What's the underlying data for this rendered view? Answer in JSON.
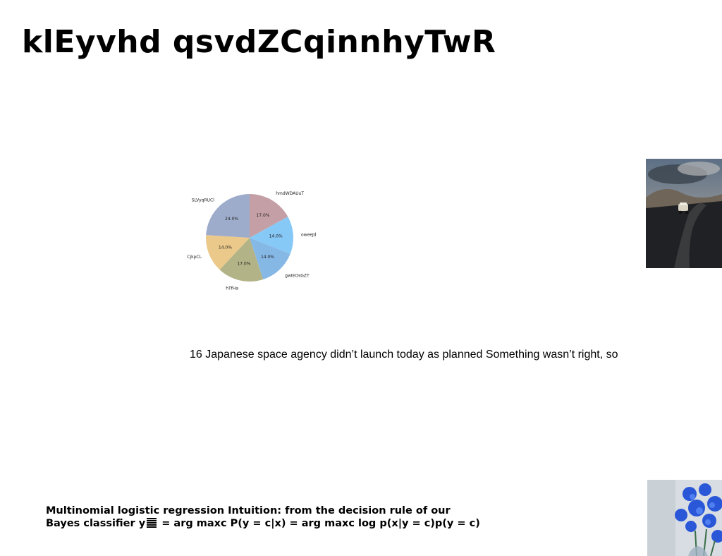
{
  "slide": {
    "title": "klEyvhd qsvdZCqinnhyTwR",
    "caption": "16 Japanese space agency didn’t launch today as planned Something wasn’t right, so",
    "bottom_text": {
      "line1": "Multinomial logistic regression Intuition: from the decision rule of our",
      "line2_prefix": "Bayes classifier y",
      "line2_suffix": " = arg maxc P(y = c|x) = arg maxc log p(x|y = c)p(y = c)"
    }
  },
  "chart_data": {
    "type": "pie",
    "labels": [
      "hmdWDAUuT",
      "oweeJd",
      "gwIEOsGZT",
      "hTfHa",
      "CjkpCL",
      "SLVyqRUCl"
    ],
    "values": [
      17.0,
      14.0,
      14.0,
      17.0,
      14.0,
      24.0
    ],
    "value_labels": [
      "17.0%",
      "14.0%",
      "14.0%",
      "17.0%",
      "14.0%",
      "24.0%"
    ],
    "colors": [
      "#c4a0a6",
      "#86c8f6",
      "#86b8e6",
      "#b3b388",
      "#ebc98a",
      "#9eaccc"
    ],
    "start_angle": 90,
    "direction": "clockwise"
  },
  "images": {
    "car_photo": "car-on-mountain-road-photo",
    "flower_photo": "blue-flowers-photo"
  }
}
